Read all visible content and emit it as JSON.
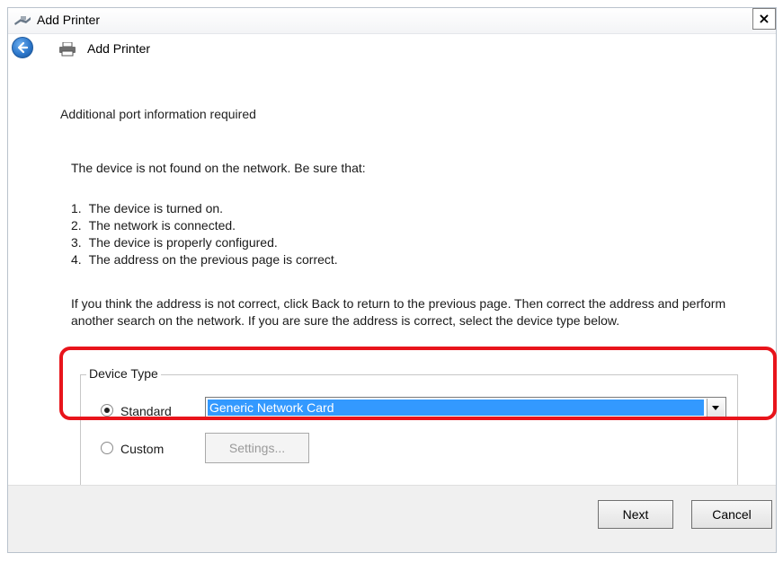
{
  "window": {
    "title": "Add Printer",
    "close_glyph": "×",
    "icons": {
      "title": "printer-wizard-icon",
      "back": "back-arrow-icon",
      "nav": "printer-icon"
    }
  },
  "nav": {
    "title": "Add Printer"
  },
  "main": {
    "heading": "Additional port information required",
    "intro": "The device is not found on the network.  Be sure that:",
    "checklist": [
      {
        "num": "1.",
        "text": "The device is turned on."
      },
      {
        "num": "2.",
        "text": "The network is connected."
      },
      {
        "num": "3.",
        "text": "The device is properly configured."
      },
      {
        "num": "4.",
        "text": "The address on the previous page is correct."
      }
    ],
    "explain": "If you think the address is not correct, click Back to return to the previous page.  Then correct the address and perform another search on the network.  If you are sure the address is correct, select the device type below."
  },
  "device_type": {
    "legend": "Device Type",
    "standard_label": "Standard",
    "standard_selected": true,
    "select_value": "Generic Network Card",
    "custom_label": "Custom",
    "custom_selected": false,
    "settings_label": "Settings..."
  },
  "highlight_color": "#e8141b",
  "footer": {
    "next_label": "Next",
    "cancel_label": "Cancel"
  }
}
